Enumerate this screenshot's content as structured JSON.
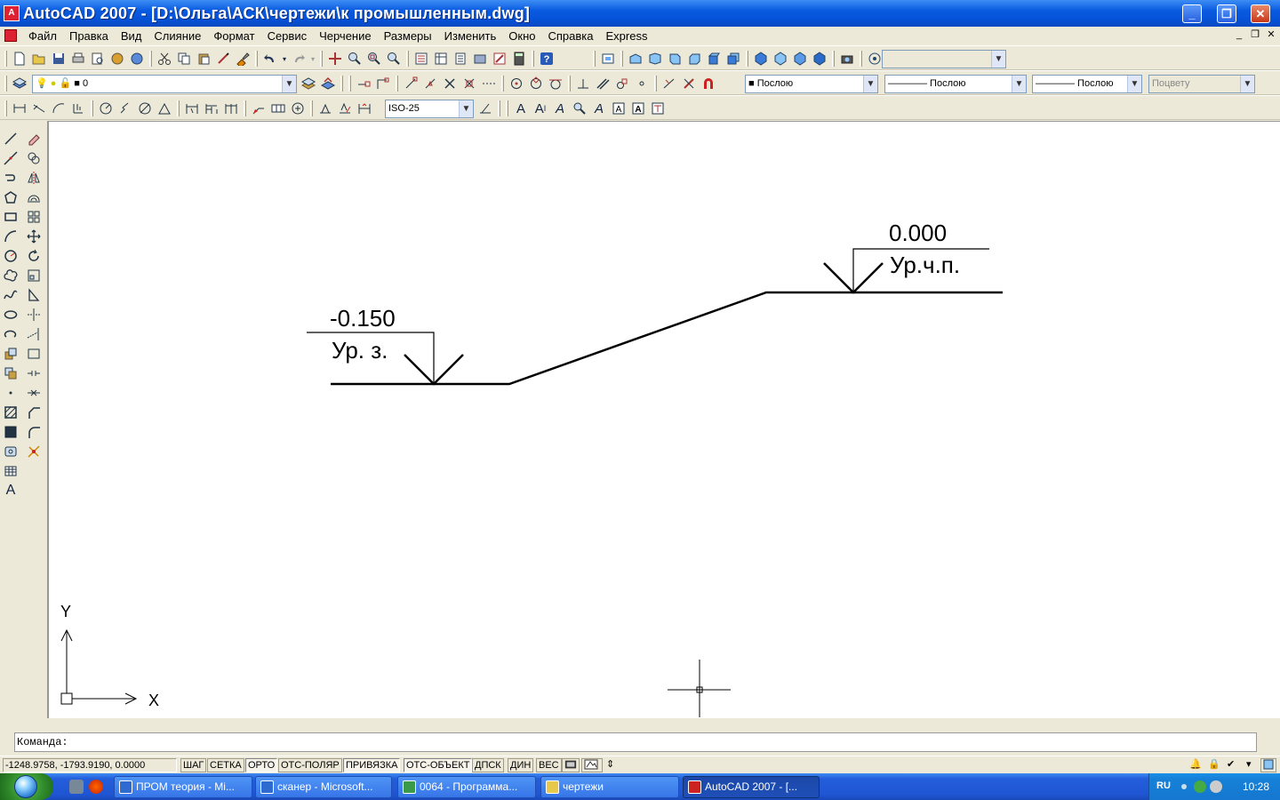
{
  "window": {
    "title": "AutoCAD 2007 - [D:\\Ольга\\АСК\\чертежи\\к промышленным.dwg]",
    "app_icon_label": "A",
    "min": "_",
    "max": "❐",
    "close": "✕"
  },
  "menu": {
    "items": [
      "Файл",
      "Правка",
      "Вид",
      "Слияние",
      "Формат",
      "Сервис",
      "Черчение",
      "Размеры",
      "Изменить",
      "Окно",
      "Справка",
      "Express"
    ],
    "doc_min": "_",
    "doc_restore": "❐",
    "doc_close": "✕"
  },
  "layers": {
    "current_layer": "0",
    "color": "■ Послою",
    "linetype": "———— Послою",
    "lineweight": "———— Послою",
    "plotstyle": "Поцвету"
  },
  "styles": {
    "dimstyle": "ISO-25"
  },
  "drawing": {
    "mark_left": {
      "value": "-0.150",
      "label": "Ур. з."
    },
    "mark_right": {
      "value": "0.000",
      "label": "Ур.ч.п."
    },
    "ucs": {
      "x_label": "X",
      "y_label": "Y"
    }
  },
  "command": {
    "prompt": "Команда:"
  },
  "status": {
    "coords": "-1248.9758, -1793.9190, 0.0000",
    "buttons": [
      "ШАГ",
      "СЕТКА",
      "ОРТО",
      "ОТС-ПОЛЯР",
      "ПРИВЯЗКА",
      "ОТС-ОБЪЕКТ",
      "ДПСК",
      "ДИН",
      "ВЕС"
    ]
  },
  "taskbar": {
    "tasks": [
      "ПРОМ теория - Mi...",
      "сканер - Microsoft...",
      "0064 - Программа...",
      "чертежи",
      "AutoCAD 2007 - [..."
    ],
    "lang": "RU",
    "clock": "10:28"
  },
  "colors": {
    "titlebar": "#0a5ae0",
    "taskbar": "#245edb",
    "canvas": "#ffffff"
  }
}
